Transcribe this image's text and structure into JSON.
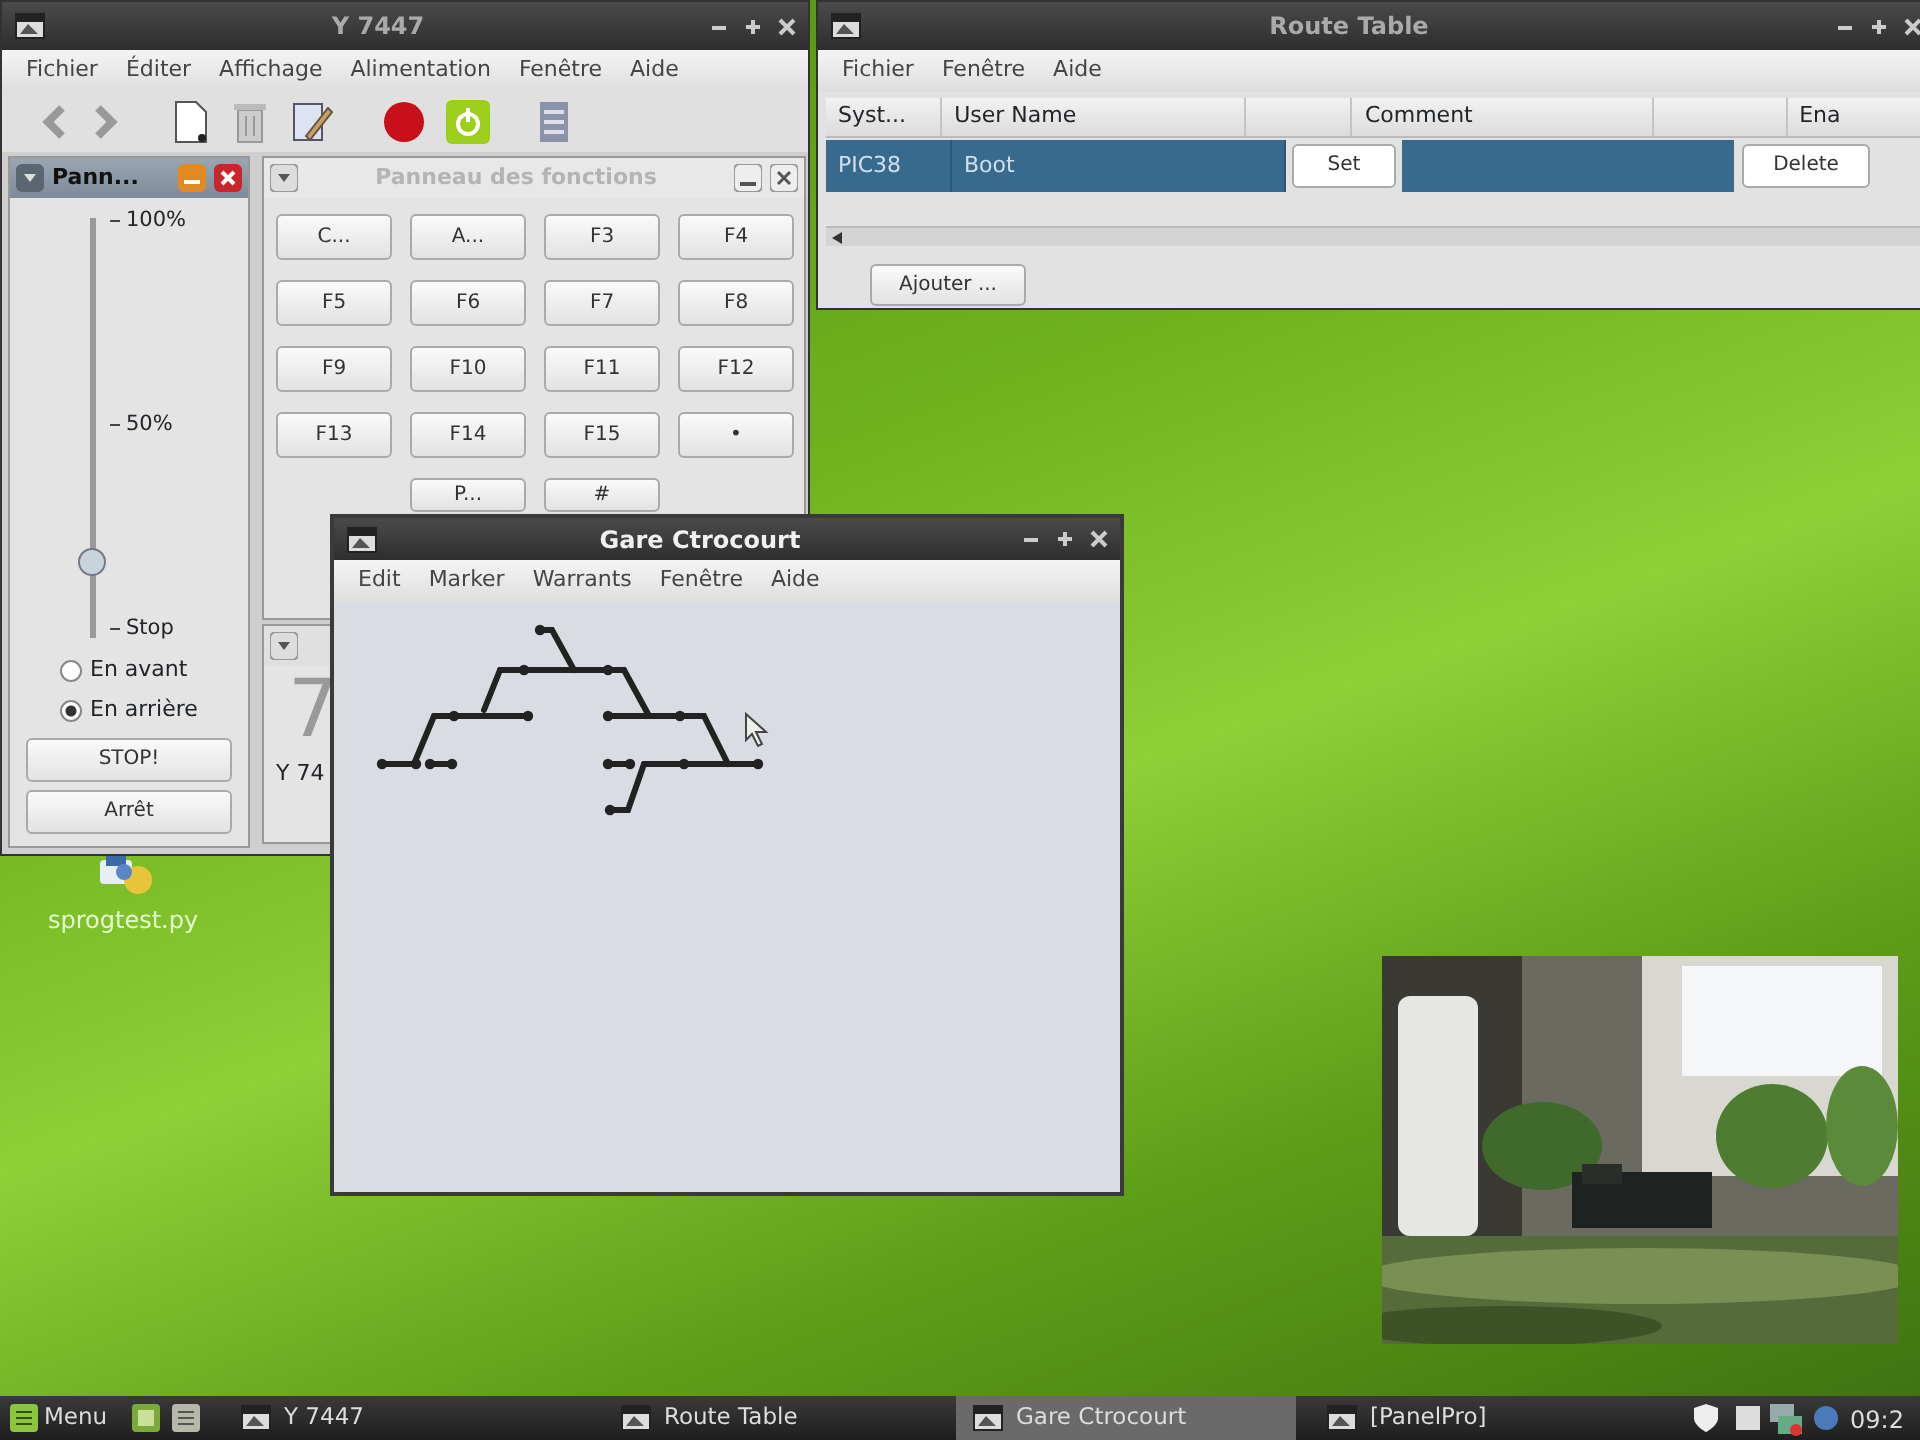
{
  "desktop": {
    "icons": [
      {
        "label": "sprogtest.py"
      }
    ]
  },
  "throttle_window": {
    "title": "Y 7447",
    "menu": [
      "Fichier",
      "Éditer",
      "Affichage",
      "Alimentation",
      "Fenêtre",
      "Aide"
    ],
    "throttle_panel": {
      "title": "Pann...",
      "speed_labels": [
        "100%",
        "50%",
        "Stop"
      ],
      "speed": {
        "level": 0.18
      },
      "directions": [
        {
          "label": "En avant",
          "selected": false
        },
        {
          "label": "En arrière",
          "selected": true
        }
      ],
      "buttons": [
        "STOP!",
        "Arrêt"
      ]
    },
    "function_panel": {
      "title": "Panneau des fonctions",
      "buttons": [
        "C...",
        "A...",
        "F3",
        "F4",
        "F5",
        "F6",
        "F7",
        "F8",
        "F9",
        "F10",
        "F11",
        "F12",
        "F13",
        "F14",
        "F15",
        "•",
        "P...",
        "#"
      ]
    },
    "address_panel": {
      "number": "7",
      "label": "Y 74"
    }
  },
  "route_table": {
    "title": "Route Table",
    "menu": [
      "Fichier",
      "Fenêtre",
      "Aide"
    ],
    "columns": [
      {
        "kind": "text",
        "label": "Syst..."
      },
      {
        "kind": "text",
        "label": "User Name"
      },
      {
        "kind": "button"
      },
      {
        "kind": "text",
        "label": "Comment"
      },
      {
        "kind": "button"
      },
      {
        "kind": "text",
        "label": "Ena"
      }
    ],
    "rows": [
      {
        "selected": true,
        "system_name": "PIC38",
        "user_name": "Boot",
        "set": "Set",
        "delete": "Delete"
      }
    ],
    "add_button": "Ajouter ..."
  },
  "layout_editor": {
    "title": "Gare Ctrocourt",
    "menu": [
      "Edit",
      "Marker",
      "Warrants",
      "Fenêtre",
      "Aide"
    ]
  },
  "taskbar": {
    "menu_label": "Menu",
    "tasks": [
      {
        "label": "Y 7447",
        "selected": false
      },
      {
        "label": "Route Table",
        "selected": false
      },
      {
        "label": "Gare Ctrocourt",
        "selected": true
      },
      {
        "label": "[PanelPro]",
        "selected": false
      }
    ],
    "clock": "09:2"
  }
}
